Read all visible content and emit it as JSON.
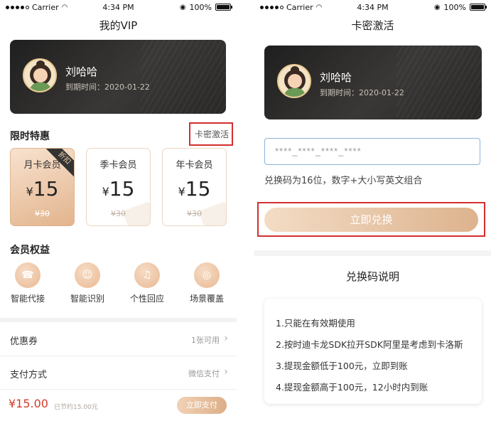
{
  "status_bar": {
    "carrier": "Carrier",
    "time": "4:34 PM",
    "battery": "100%"
  },
  "left": {
    "title": "我的VIP",
    "user": {
      "name": "刘哈哈",
      "expiry": "到期时间：2020-01-22"
    },
    "offers": {
      "title": "限时特惠",
      "activate_link": "卡密激活",
      "plans": [
        {
          "name": "月卡会员",
          "currency": "¥",
          "price": "15",
          "original": "¥30",
          "badge": "折扣"
        },
        {
          "name": "季卡会员",
          "currency": "¥",
          "price": "15",
          "original": "¥30"
        },
        {
          "name": "年卡会员",
          "currency": "¥",
          "price": "15",
          "original": "¥30"
        }
      ]
    },
    "benefits": {
      "title": "会员权益",
      "items": [
        {
          "label": "智能代接",
          "icon": "phone-icon"
        },
        {
          "label": "智能识别",
          "icon": "user-icon"
        },
        {
          "label": "个性回应",
          "icon": "headset-icon"
        },
        {
          "label": "场景覆盖",
          "icon": "location-icon"
        }
      ]
    },
    "coupon": {
      "label": "优惠券",
      "value": "1张可用"
    },
    "payment": {
      "label": "支付方式",
      "value": "微信支付"
    },
    "footer": {
      "amount": "¥15.00",
      "saved": "已节约15.00元",
      "pay_button": "立即支付"
    },
    "colors": {
      "accent": "#d63b2a",
      "gold": "#e2b48d",
      "highlight": "#d32f2f"
    }
  },
  "right": {
    "title": "卡密激活",
    "user": {
      "name": "刘哈哈",
      "expiry": "到期时间：2020-01-22"
    },
    "input_placeholder": "****_****_****_****",
    "hint": "兑换码为16位，数字+大小写英文组合",
    "redeem_button": "立即兑换",
    "explain_title": "兑换码说明",
    "explain_lines": [
      "1.只能在有效期使用",
      "2.按时迪卡龙SDK拉开SDK阿里是考虑到卡洛斯",
      "3.提现金额低于100元，立即到账",
      "4.提现金额高于100元，12小时内到账"
    ]
  }
}
